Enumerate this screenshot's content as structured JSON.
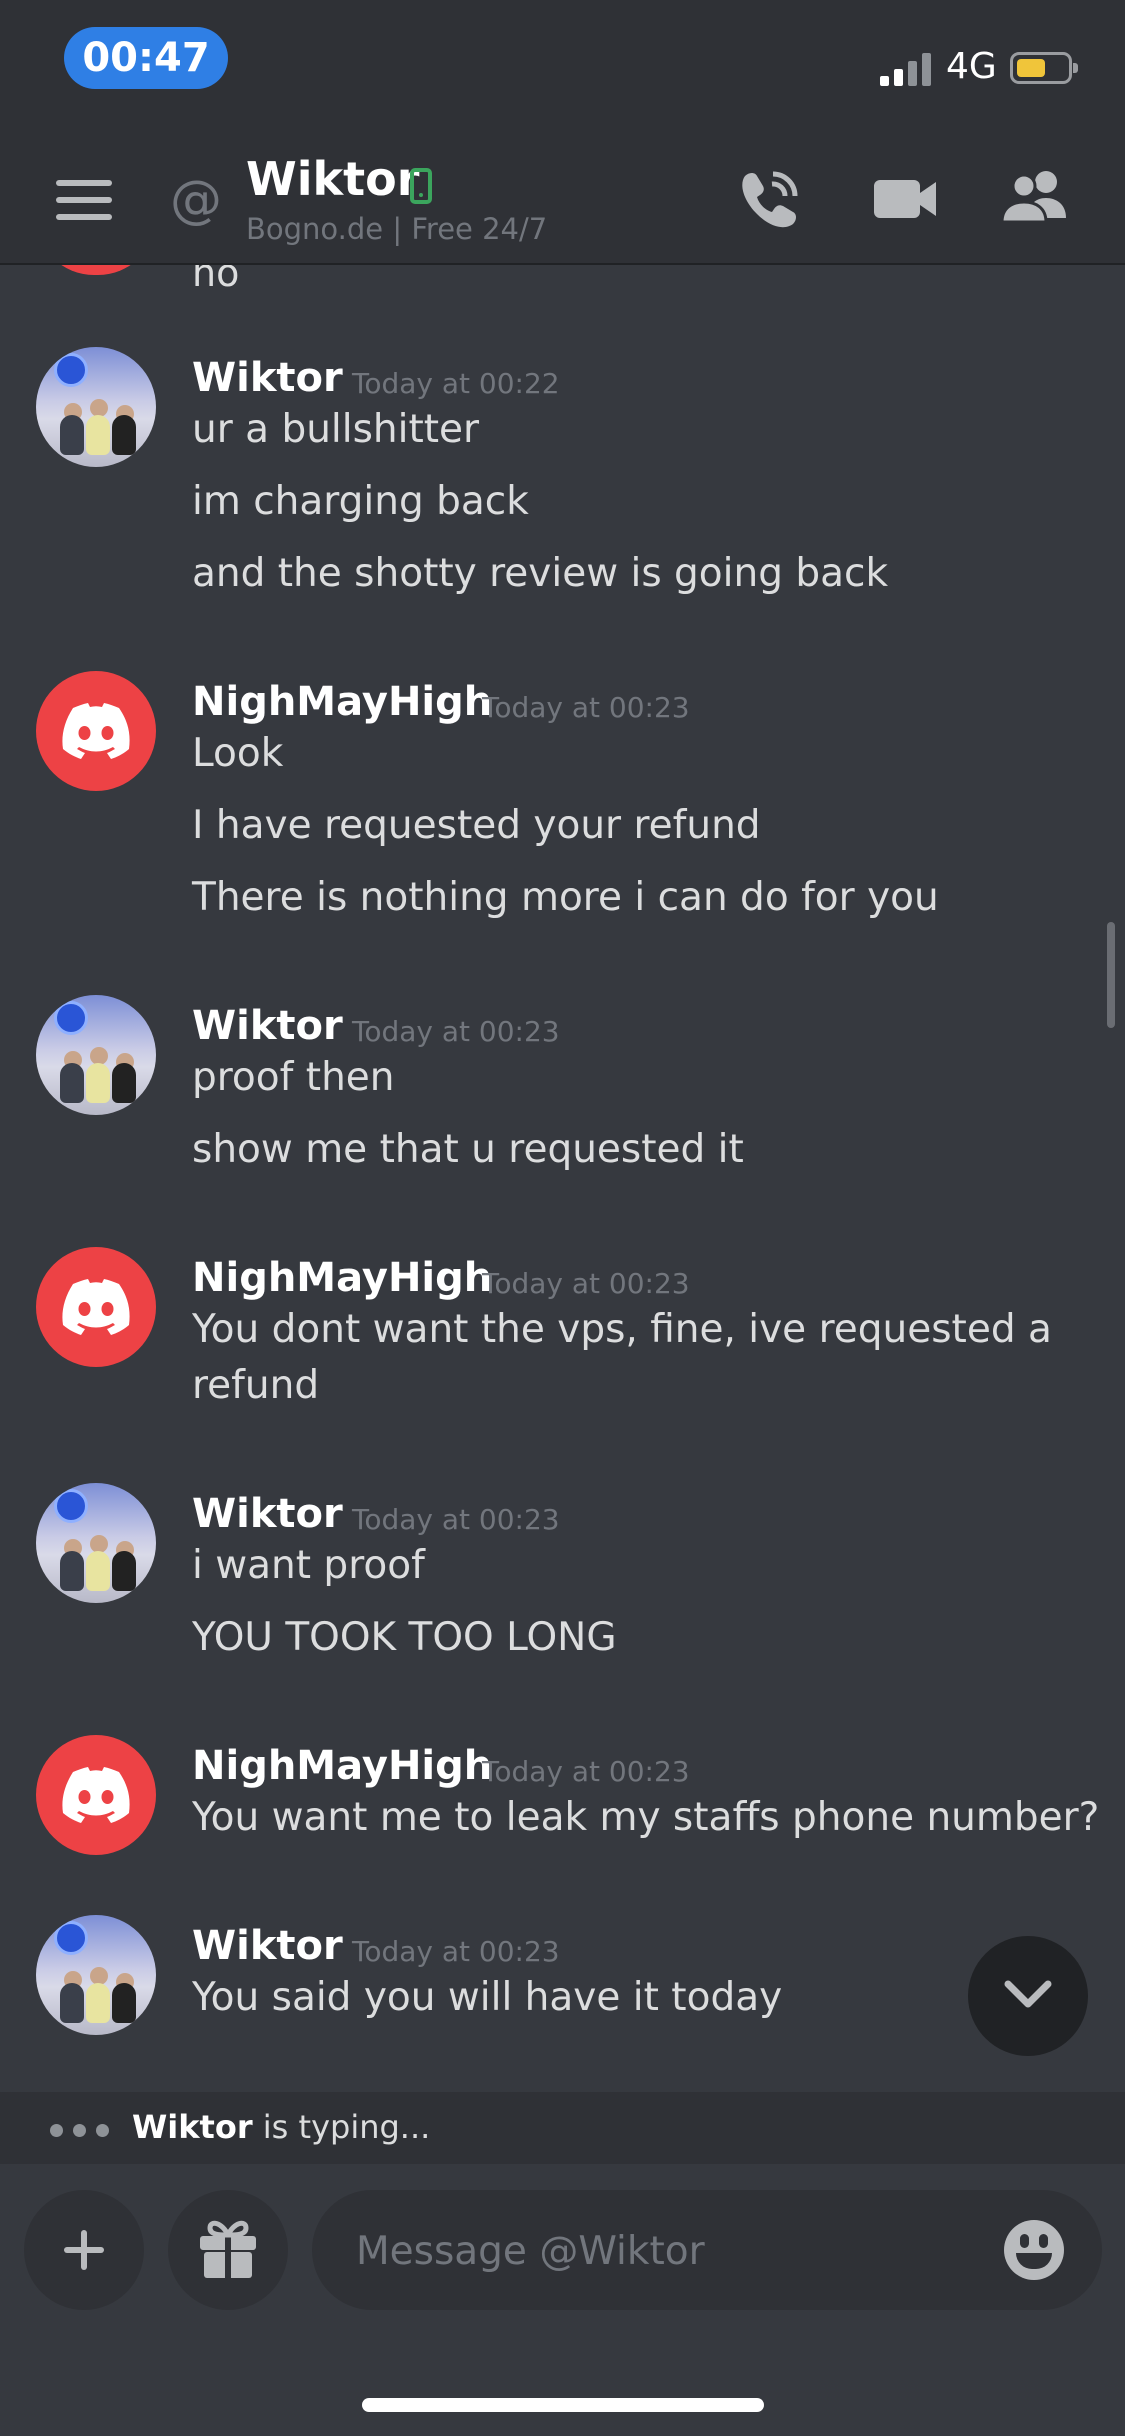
{
  "status": {
    "time": "00:47",
    "network": "4G"
  },
  "header": {
    "name": "Wiktor",
    "subtitle": "Bogno.de  | Free 24/7"
  },
  "chat": {
    "cut_text": "no",
    "groups": [
      {
        "author": "Wiktor",
        "timestamp": "Today at 00:22",
        "avatar": "photo",
        "lines": [
          "ur a bullshitter",
          "im charging back",
          "and the shotty review is going back"
        ]
      },
      {
        "author": "NighMayHigh",
        "timestamp": "Today at 00:23",
        "avatar": "discord",
        "lines": [
          "Look",
          "I have requested your refund",
          "There is nothing more i can do for you"
        ]
      },
      {
        "author": "Wiktor",
        "timestamp": "Today at 00:23",
        "avatar": "photo",
        "lines": [
          "proof then",
          "show me that u requested it"
        ]
      },
      {
        "author": "NighMayHigh",
        "timestamp": "Today at 00:23",
        "avatar": "discord",
        "lines": [
          "You dont want the vps, fine, ive requested a",
          "refund"
        ]
      },
      {
        "author": "Wiktor",
        "timestamp": "Today at 00:23",
        "avatar": "photo",
        "lines": [
          "i want proof",
          "YOU TOOK TOO LONG"
        ]
      },
      {
        "author": "NighMayHigh",
        "timestamp": "Today at 00:23",
        "avatar": "discord",
        "lines": [
          "You want me to leak my staffs phone number?"
        ]
      },
      {
        "author": "Wiktor",
        "timestamp": "Today at 00:23",
        "avatar": "photo",
        "lines": [
          "You said you will have it today"
        ]
      }
    ]
  },
  "typing": {
    "user": "Wiktor",
    "text": " is typing..."
  },
  "composer": {
    "placeholder": "Message @Wiktor"
  },
  "colors": {
    "background": "#36393f",
    "header": "#2f3136",
    "discord_red": "#ed4245",
    "online_green": "#3ba55d",
    "time_pill": "#2f7fe5"
  },
  "icons": [
    "hamburger-icon",
    "at-icon",
    "mobile-status-icon",
    "voice-call-icon",
    "video-call-icon",
    "members-icon",
    "discord-icon",
    "chevron-down-icon",
    "plus-icon",
    "gift-icon",
    "emoji-icon"
  ]
}
